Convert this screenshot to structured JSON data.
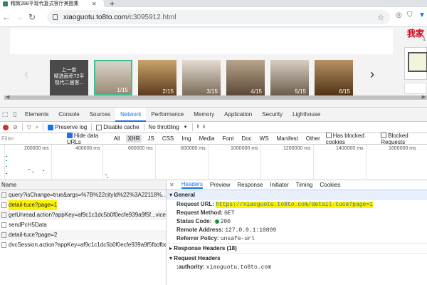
{
  "browser": {
    "tab_title": "精致288平现代复式客厅美图集",
    "url_host": "xiaoguotu.to8to.com",
    "url_path": "/c3095912.html"
  },
  "page": {
    "brand": "我家",
    "brand_sub": "1",
    "thumbs": [
      {
        "num": "",
        "text": "上一套\n精选面积72平\n现代二居客..."
      },
      {
        "num": "1/15",
        "text": ""
      },
      {
        "num": "2/15",
        "text": ""
      },
      {
        "num": "3/15",
        "text": ""
      },
      {
        "num": "4/15",
        "text": ""
      },
      {
        "num": "5/15",
        "text": ""
      },
      {
        "num": "6/15",
        "text": ""
      }
    ]
  },
  "devtools": {
    "tabs": [
      "Elements",
      "Console",
      "Sources",
      "Network",
      "Performance",
      "Memory",
      "Application",
      "Security",
      "Lighthouse"
    ],
    "active_tab": "Network",
    "preserve_log": "Preserve log",
    "disable_cache": "Disable cache",
    "throttle": "No throttling",
    "filter_placeholder": "Filter",
    "hide_data_urls": "Hide data URLs",
    "types": [
      "All",
      "XHR",
      "JS",
      "CSS",
      "Img",
      "Media",
      "Font",
      "Doc",
      "WS",
      "Manifest",
      "Other"
    ],
    "has_blocked_cookies": "Has blocked cookies",
    "blocked_requests": "Blocked Requests",
    "ticks": [
      "200000 ms",
      "400000 ms",
      "600000 ms",
      "800000 ms",
      "1000000 ms",
      "1200000 ms",
      "1400000 ms",
      "1600000 ms"
    ],
    "name_header": "Name",
    "requests": [
      "query?isChange=true&args=%7B%22cityId%22%3A22118%...",
      "detail-tuce?page=1",
      "getUnread.action?appKey=af9c1c1dc5b0f0ecfe939a9f5f...viceId=",
      "sendPcH5Data",
      "detail-tuce?page=2",
      "dvcSession.action?appKey=af9c1c1dc5b0f0ecfe939a9f5fbdfbd6&..."
    ],
    "detail_tabs": [
      "Headers",
      "Preview",
      "Response",
      "Initiator",
      "Timing",
      "Cookies"
    ],
    "general_label": "General",
    "general": [
      {
        "k": "Request URL:",
        "v": "https://xiaoguotu.to8to.com/detail-tuce?page=1"
      },
      {
        "k": "Request Method:",
        "v": "GET"
      },
      {
        "k": "Status Code:",
        "v": "200"
      },
      {
        "k": "Remote Address:",
        "v": "127.0.0.1:10809"
      },
      {
        "k": "Referrer Policy:",
        "v": "unsafe-url"
      }
    ],
    "response_headers": "Response Headers (18)",
    "request_headers": "Request Headers",
    "authority_k": ":authority:",
    "authority_v": "xiaoguotu.to8to.com"
  },
  "colors": {
    "accent": "#1a73e8",
    "highlight": "#fff200",
    "record": "#d93025",
    "ok": "#1e8e3e"
  }
}
